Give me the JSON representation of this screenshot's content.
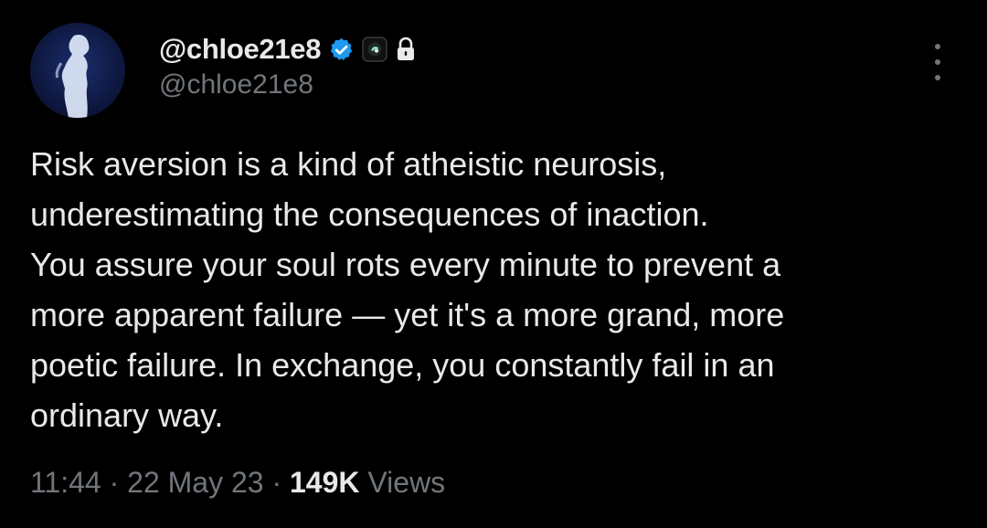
{
  "author": {
    "display_name": "@chloe21e8",
    "handle": "@chloe21e8",
    "verified_icon": "verified-badge-icon",
    "affiliate_icon": "affiliate-badge-icon",
    "protected_icon": "lock-icon"
  },
  "menu": {
    "icon": "more-options-icon"
  },
  "tweet": {
    "text": "Risk aversion is a kind of atheistic neurosis,\nunderestimating the consequences of inaction.\nYou assure your soul rots every minute to prevent a\nmore apparent failure — yet it's a more grand, more\npoetic failure. In exchange, you constantly fail in an\nordinary way.",
    "time": "11:44",
    "separator": " · ",
    "date": "22 May 23",
    "views_count": "149K",
    "views_label": " Views"
  },
  "colors": {
    "background": "#000000",
    "primary_text": "#e7e9ea",
    "secondary_text": "#71767b",
    "verified_blue": "#1d9bf0"
  }
}
